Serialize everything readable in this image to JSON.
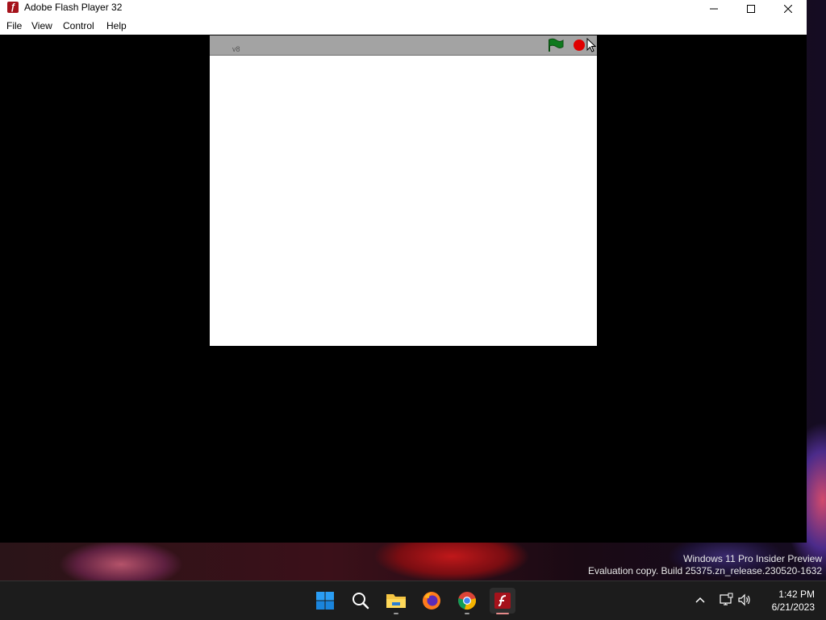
{
  "window": {
    "title": "Adobe Flash Player 32",
    "app_icon_glyph": "ƒ",
    "controls": {
      "minimize": "minimize-icon",
      "maximize": "maximize-icon",
      "close": "close-icon"
    }
  },
  "menu": {
    "file": "File",
    "view": "View",
    "control": "Control",
    "help": "Help"
  },
  "stage": {
    "version_label": "v8",
    "green_flag_icon": "green-flag-icon",
    "stop_icon": "stop-sign-icon",
    "colors": {
      "bar": "#a3a3a3",
      "flag": "#0f7a1e",
      "stop": "#e00000"
    }
  },
  "desktop": {
    "watermark_line1": "Windows 11 Pro Insider Preview",
    "watermark_line2": "Evaluation copy. Build 25375.zn_release.230520-1632"
  },
  "taskbar": {
    "apps": [
      "start-icon",
      "search-icon",
      "file-explorer-icon",
      "firefox-icon",
      "chrome-icon",
      "flash-player-icon"
    ],
    "clock_time": "1:42 PM",
    "clock_date": "6/21/2023"
  }
}
